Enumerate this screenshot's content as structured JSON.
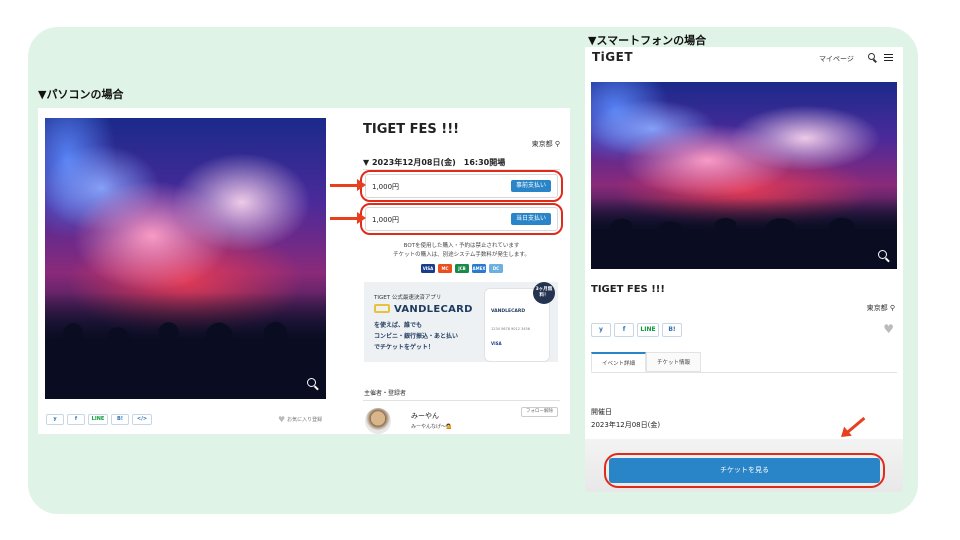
{
  "labels": {
    "pc": "▼パソコンの場合",
    "sp": "▼スマートフォンの場合"
  },
  "pc": {
    "title": "TIGET FES !!!",
    "location": "東京都",
    "date": "▼ 2023年12月08日(金)　16:30開場",
    "tickets": [
      {
        "price": "1,000円",
        "button": "事前支払い"
      },
      {
        "price": "1,000円",
        "button": "当日支払い"
      }
    ],
    "notice_1": "BOTを使用した購入・予約は禁止されています",
    "notice_2": "チケットの購入は、別途システム手数料が発生します。",
    "cards": [
      "VISA",
      "MC",
      "JCB",
      "AMEX",
      "DC"
    ],
    "banner": {
      "small": "TIGET 公式最速決済アプリ",
      "brand": "VANDLECARD",
      "line1": "を使えば、誰でも",
      "line2": "コンビニ・銀行振込・あと払い",
      "line3": "でチケットをゲット！",
      "badge": "3ヶ月無料！",
      "mock_brand": "VANDLECARD",
      "mock_number": "1234 5678 9012 3456",
      "mock_visa": "VISA"
    },
    "organizer_label": "主催者・登録者",
    "organizer_name": "みーやん",
    "organizer_sub": "みーやんなげ〜💁",
    "follow": "フォロー解除",
    "share": [
      "y",
      "f",
      "LINE",
      "B!",
      "</>"
    ],
    "favorite": "お気に入り登録"
  },
  "sp": {
    "logo": "TiGET",
    "mypage": "マイページ",
    "title": "TIGET FES !!!",
    "location": "東京都",
    "share": [
      "y",
      "f",
      "LINE",
      "B!"
    ],
    "tabs": [
      "イベント詳細",
      "チケット情報"
    ],
    "date_heading": "開催日",
    "date": "2023年12月08日(金)",
    "ticket_button": "チケットを見る"
  },
  "colors": {
    "background_green": "#dff3e6",
    "accent_blue": "#2a85c8",
    "highlight_red": "#e02b1b"
  }
}
